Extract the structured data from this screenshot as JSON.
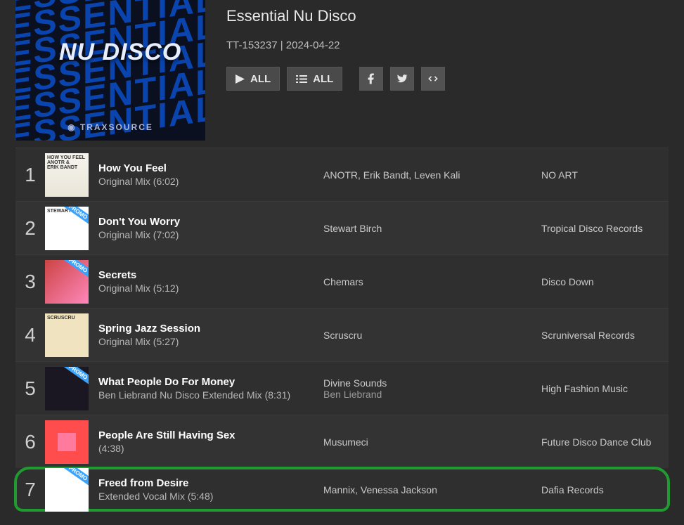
{
  "cover": {
    "bg_repeat": "ESSENTIAL",
    "main_text": "NU DISCO",
    "brand": "TRAXSOURCE"
  },
  "header": {
    "title": "Essential Nu Disco",
    "cat_date": "TT-153237 | 2024-04-22",
    "play_all": "ALL",
    "queue_all": "ALL"
  },
  "tracks": [
    {
      "rank": "1",
      "title": "How You Feel",
      "mix": "Original Mix (6:02)",
      "artist": "ANOTR, Erik Bandt, Leven Kali",
      "sub_artist": "",
      "label": "NO ART",
      "promo": false,
      "art": "art1",
      "art_text": "HOW YOU FEEL\nANOTR &\nERIK BANDT\n"
    },
    {
      "rank": "2",
      "title": "Don't You Worry",
      "mix": "Original Mix (7:02)",
      "artist": "Stewart Birch",
      "sub_artist": "",
      "label": "Tropical Disco Records",
      "promo": true,
      "art": "art2",
      "art_text": "STEWART"
    },
    {
      "rank": "3",
      "title": "Secrets",
      "mix": "Original Mix (5:12)",
      "artist": "Chemars",
      "sub_artist": "",
      "label": "Disco Down",
      "promo": true,
      "art": "art3",
      "art_text": ""
    },
    {
      "rank": "4",
      "title": "Spring Jazz Session",
      "mix": "Original Mix (5:27)",
      "artist": "Scruscru",
      "sub_artist": "",
      "label": "Scruniversal Records",
      "promo": false,
      "art": "art4",
      "art_text": "SCRUSCRU"
    },
    {
      "rank": "5",
      "title": "What People Do For Money",
      "mix": "Ben Liebrand Nu Disco Extended Mix (8:31)",
      "artist": "Divine Sounds",
      "sub_artist": "Ben Liebrand",
      "label": "High Fashion Music",
      "promo": true,
      "art": "art5",
      "art_text": ""
    },
    {
      "rank": "6",
      "title": "People Are Still Having Sex",
      "mix": "(4:38)",
      "artist": "Musumeci",
      "sub_artist": "",
      "label": "Future Disco Dance Club",
      "promo": false,
      "art": "art6",
      "art_text": ""
    },
    {
      "rank": "7",
      "title": "Freed from Desire",
      "mix": "Extended Vocal Mix (5:48)",
      "artist": "Mannix, Venessa Jackson",
      "sub_artist": "",
      "label": "Dafia Records",
      "promo": true,
      "art": "art7",
      "art_text": "",
      "highlight": true
    }
  ]
}
